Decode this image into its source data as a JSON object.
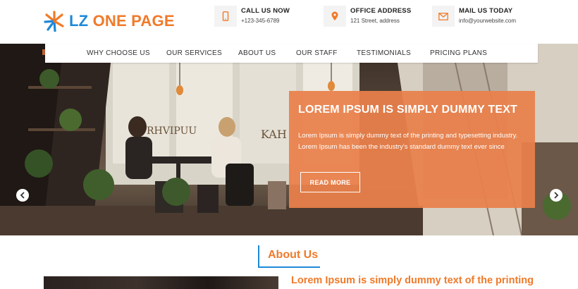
{
  "brand": {
    "logo_prefix": "LZ",
    "logo_rest": "ONE PAGE",
    "logo_icon": "sunburst-logo-icon",
    "colors": {
      "orange": "#f07a2a",
      "blue": "#1e88d8",
      "slide_overlay": "#ea804a"
    }
  },
  "contacts": [
    {
      "icon": "phone-icon",
      "title": "CALL US NOW",
      "value": "+123-345-6789"
    },
    {
      "icon": "location-pin-icon",
      "title": "OFFICE ADDRESS",
      "value": "121 Street, address"
    },
    {
      "icon": "envelope-icon",
      "title": "MAIL US TODAY",
      "value": "info@yourwebsite.com"
    }
  ],
  "nav": {
    "items": [
      "WHY CHOOSE US",
      "OUR SERVICES",
      "ABOUT US",
      "OUR STAFF",
      "TESTIMONIALS",
      "PRICING PLANS"
    ]
  },
  "slider": {
    "title": "LOREM IPSUM IS SIMPLY DUMMY TEXT",
    "body": "Lorem Ipsum is simply dummy text of the printing and typesetting industry. Lorem Ipsum has been the industry's standard dummy text ever since",
    "button": "READ MORE",
    "prev_icon": "chevron-left-icon",
    "next_icon": "chevron-right-icon",
    "cafe_sign_left": "RHVIPUU",
    "cafe_sign_right": "KAH"
  },
  "about": {
    "heading": "About Us",
    "subheading": "Lorem Ipsum is simply dummy text of the printing"
  }
}
